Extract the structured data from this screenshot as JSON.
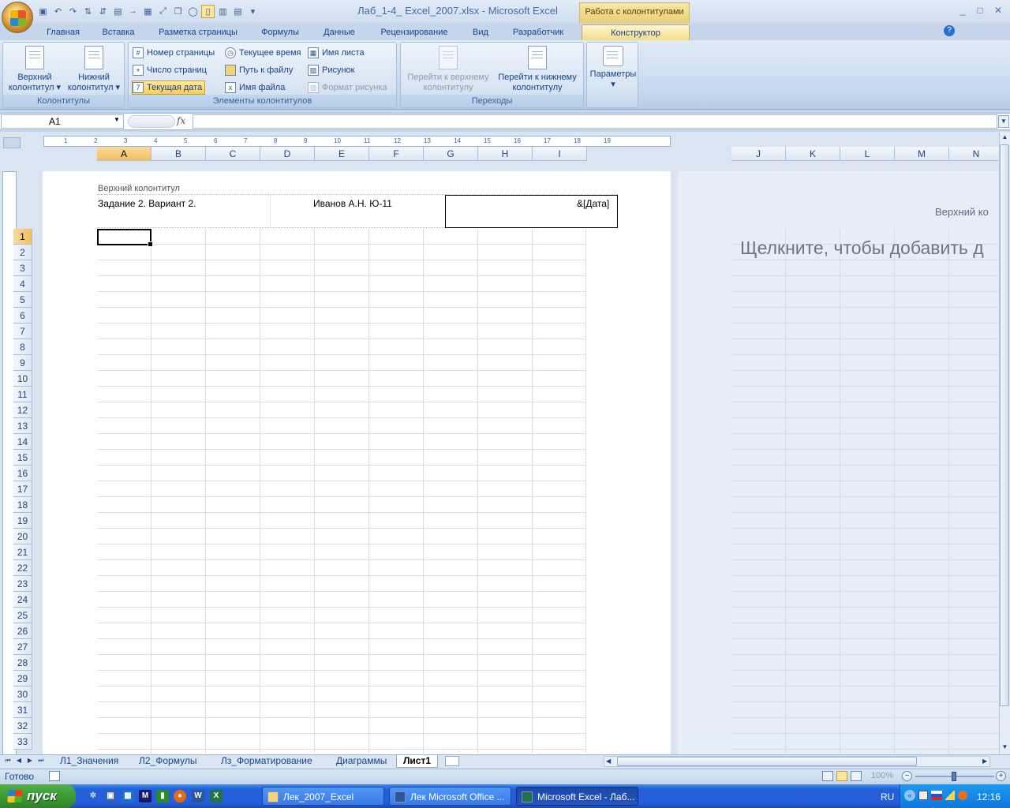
{
  "window": {
    "title": "Лаб_1-4_ Excel_2007.xlsx - Microsoft Excel",
    "context_title": "Работа с колонтитулами",
    "controls": [
      "_",
      "□",
      "✕"
    ]
  },
  "ribbon_tabs": [
    {
      "label": "Главная"
    },
    {
      "label": "Вставка"
    },
    {
      "label": "Разметка страницы"
    },
    {
      "label": "Формулы"
    },
    {
      "label": "Данные"
    },
    {
      "label": "Рецензирование"
    },
    {
      "label": "Вид"
    },
    {
      "label": "Разработчик"
    },
    {
      "label": "Конструктор"
    }
  ],
  "active_tab": "Конструктор",
  "ribbon": {
    "headers_group": {
      "label": "Колонтитулы",
      "header_btn": {
        "line1": "Верхний",
        "line2": "колонтитул ▾"
      },
      "footer_btn": {
        "line1": "Нижний",
        "line2": "колонтитул ▾"
      }
    },
    "elements_group": {
      "label": "Элементы колонтитулов",
      "page_number": "Номер страницы",
      "page_count": "Число страниц",
      "current_date": "Текущая дата",
      "current_time": "Текущее время",
      "file_path": "Путь к файлу",
      "file_name": "Имя файла",
      "sheet_name": "Имя листа",
      "picture": "Рисунок",
      "picture_format": "Формат рисунка"
    },
    "navigation_group": {
      "label": "Переходы",
      "to_header": {
        "line1": "Перейти к верхнему",
        "line2": "колонтитулу"
      },
      "to_footer": {
        "line1": "Перейти к нижнему",
        "line2": "колонтитулу"
      }
    },
    "options_group": {
      "label": "Параметры",
      "arrow": "▾"
    }
  },
  "formula_bar": {
    "name_box": "A1",
    "fx": "fx",
    "value": ""
  },
  "columns_page1": [
    "A",
    "B",
    "C",
    "D",
    "E",
    "F",
    "G",
    "H",
    "I"
  ],
  "columns_page2": [
    "J",
    "K",
    "L",
    "M",
    "N"
  ],
  "rows": [
    "1",
    "2",
    "3",
    "4",
    "5",
    "6",
    "7",
    "8",
    "9",
    "10",
    "11",
    "12",
    "13",
    "14",
    "15",
    "16",
    "17",
    "18",
    "19",
    "20",
    "21",
    "22",
    "23",
    "24",
    "25",
    "26",
    "27",
    "28",
    "29",
    "30",
    "31",
    "32",
    "33"
  ],
  "ruler_marks": [
    "1",
    "2",
    "3",
    "4",
    "5",
    "6",
    "7",
    "8",
    "9",
    "10",
    "11",
    "12",
    "13",
    "14",
    "15",
    "16",
    "17",
    "18",
    "19"
  ],
  "page1_header": {
    "label": "Верхний колонтитул",
    "left": "Задание 2. Вариант 2.",
    "center": "Иванов А.Н. Ю-11",
    "right": "&[Дата]"
  },
  "page2_header": {
    "label": "Верхний ко",
    "click_prompt": "Щелкните, чтобы добавить д"
  },
  "sheet_tabs": [
    {
      "label": "Л1_Значения"
    },
    {
      "label": "Л2_Формулы"
    },
    {
      "label": "Лз_Форматирование"
    },
    {
      "label": "Диаграммы"
    },
    {
      "label": "Лист1"
    }
  ],
  "active_sheet": "Лист1",
  "status": {
    "text": "Готово",
    "zoom": "100%"
  },
  "taskbar": {
    "start": "пуск",
    "buttons": [
      {
        "label": "Лек_2007_Excel"
      },
      {
        "label": "Лек Microsoft Office ..."
      },
      {
        "label": "Microsoft Excel - Лаб..."
      }
    ],
    "lang": "RU",
    "clock": "12:16"
  }
}
